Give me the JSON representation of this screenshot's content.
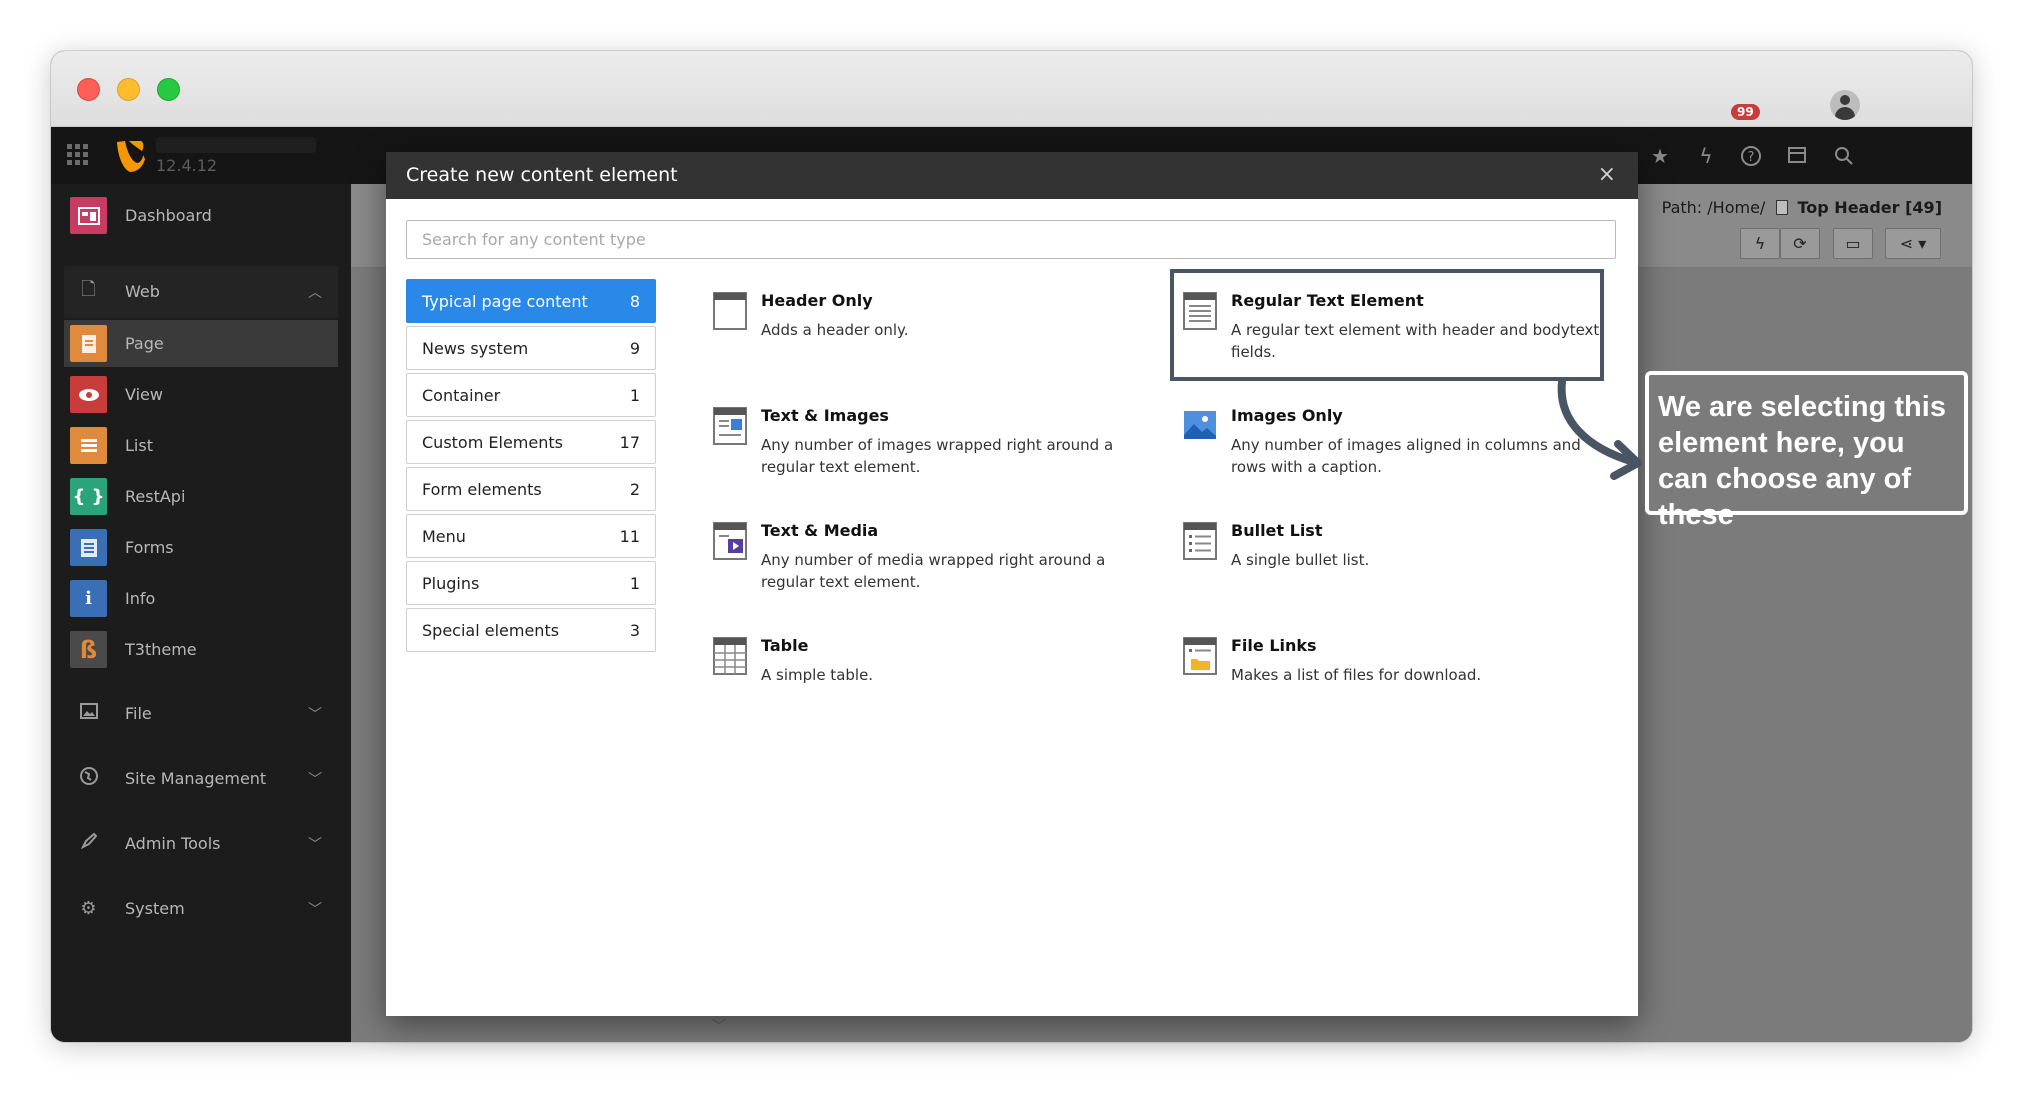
{
  "topbar": {
    "version": "12.4.12",
    "notification_count": "99"
  },
  "sidebar": {
    "dashboard": "Dashboard",
    "web_group": "Web",
    "modules": [
      {
        "label": "Page",
        "color": "#e08a3e",
        "icon": "page-icon"
      },
      {
        "label": "View",
        "color": "#c83c3c",
        "icon": "view-icon"
      },
      {
        "label": "List",
        "color": "#e08a3e",
        "icon": "list-icon"
      },
      {
        "label": "RestApi",
        "color": "#2ba47c",
        "icon": "restapi-icon"
      },
      {
        "label": "Forms",
        "color": "#3a6fb5",
        "icon": "forms-icon"
      },
      {
        "label": "Info",
        "color": "#3a6fb5",
        "icon": "info-icon"
      },
      {
        "label": "T3theme",
        "color": "#4a4a4a",
        "icon": "t3theme-icon"
      }
    ],
    "groups": [
      "File",
      "Site Management",
      "Admin Tools",
      "System"
    ]
  },
  "docheader": {
    "path_label": "Path: /Home/",
    "page_title": "Top Header [49]"
  },
  "modal": {
    "title": "Create new content element",
    "search_placeholder": "Search for any content type",
    "categories": [
      {
        "label": "Typical page content",
        "count": "8"
      },
      {
        "label": "News system",
        "count": "9"
      },
      {
        "label": "Container",
        "count": "1"
      },
      {
        "label": "Custom Elements",
        "count": "17"
      },
      {
        "label": "Form elements",
        "count": "2"
      },
      {
        "label": "Menu",
        "count": "11"
      },
      {
        "label": "Plugins",
        "count": "1"
      },
      {
        "label": "Special elements",
        "count": "3"
      }
    ],
    "elements": [
      {
        "title": "Header Only",
        "desc": "Adds a header only.",
        "icon": "header-only-icon"
      },
      {
        "title": "Regular Text Element",
        "desc": "A regular text element with header and bodytext fields.",
        "icon": "text-element-icon"
      },
      {
        "title": "Text & Images",
        "desc": "Any number of images wrapped right around a regular text element.",
        "icon": "text-images-icon"
      },
      {
        "title": "Images Only",
        "desc": "Any number of images aligned in columns and rows with a caption.",
        "icon": "images-only-icon"
      },
      {
        "title": "Text & Media",
        "desc": "Any number of media wrapped right around a regular text element.",
        "icon": "text-media-icon"
      },
      {
        "title": "Bullet List",
        "desc": "A single bullet list.",
        "icon": "bullet-list-icon"
      },
      {
        "title": "Table",
        "desc": "A simple table.",
        "icon": "table-icon"
      },
      {
        "title": "File Links",
        "desc": "Makes a list of files for download.",
        "icon": "file-links-icon"
      }
    ]
  },
  "annotation": {
    "text": "We are selecting this element here, you can choose any of these"
  }
}
